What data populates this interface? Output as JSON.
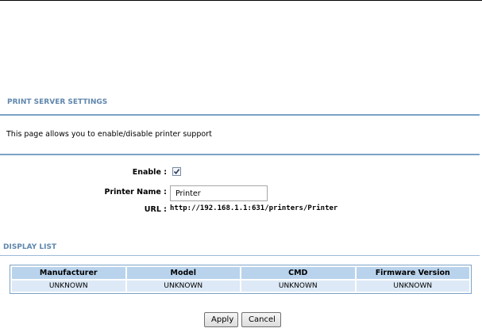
{
  "print_server": {
    "title": "PRINT SERVER SETTINGS",
    "description": "This page allows you to enable/disable printer support"
  },
  "form": {
    "enable_label": "Enable :",
    "enable_checked": true,
    "printer_name_label": "Printer Name :",
    "printer_name_value": "Printer",
    "url_label": "URL :",
    "url_value": "http://192.168.1.1:631/printers/Printer"
  },
  "display_list": {
    "title": "DISPLAY LIST",
    "columns": [
      "Manufacturer",
      "Model",
      "CMD",
      "Firmware Version"
    ],
    "rows": [
      [
        "UNKNOWN",
        "UNKNOWN",
        "UNKNOWN",
        "UNKNOWN"
      ]
    ]
  },
  "buttons": {
    "apply_label": "Apply",
    "cancel_label": "Cancel"
  },
  "colors": {
    "section_title": "#5f86ad",
    "rule": "#7aa2c8",
    "header_cell": "#b9d3ec",
    "data_cell": "#dde9f6"
  }
}
